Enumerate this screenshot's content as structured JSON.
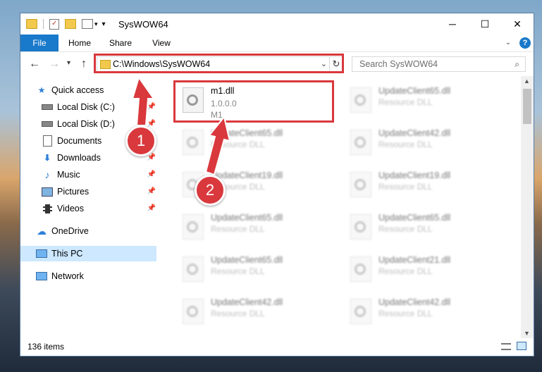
{
  "window": {
    "title": "SysWOW64",
    "controls": {
      "minimize": "─",
      "maximize": "☐",
      "close": "✕"
    }
  },
  "ribbon": {
    "tabs": [
      "File",
      "Home",
      "Share",
      "View"
    ],
    "help_icon": "?",
    "expand_icon": "⌄"
  },
  "address_bar": {
    "path": "C:\\Windows\\SysWOW64",
    "search_placeholder": "Search SysWOW64"
  },
  "sidebar": {
    "quick_access": "Quick access",
    "items": [
      {
        "label": "Local Disk (C:)",
        "icon": "drive-icon"
      },
      {
        "label": "Local Disk (D:)",
        "icon": "drive-icon"
      },
      {
        "label": "Documents",
        "icon": "documents-icon"
      },
      {
        "label": "Downloads",
        "icon": "downloads-icon"
      },
      {
        "label": "Music",
        "icon": "music-icon"
      },
      {
        "label": "Pictures",
        "icon": "pictures-icon"
      },
      {
        "label": "Videos",
        "icon": "videos-icon"
      }
    ],
    "onedrive": "OneDrive",
    "this_pc": "This PC",
    "network": "Network"
  },
  "files": {
    "highlighted": {
      "name": "m1.dll",
      "version": "1.0.0.0",
      "description": "M1"
    },
    "right_column": [
      {
        "name": "UpdateClient65.dll",
        "type": "Resource DLL"
      },
      {
        "name": "UpdateClient42.dll",
        "type": "Resource DLL"
      },
      {
        "name": "UpdateClient19.dll",
        "type": "Resource DLL"
      },
      {
        "name": "UpdateClient65.dll",
        "type": "Resource DLL"
      },
      {
        "name": "UpdateClient21.dll",
        "type": "Resource DLL"
      },
      {
        "name": "UpdateClient42.dll",
        "type": "Resource DLL"
      }
    ],
    "left_column": [
      {
        "name": "UpdateClient65.dll",
        "type": "Resource DLL"
      },
      {
        "name": "UpdateClient19.dll",
        "type": "Resource DLL"
      },
      {
        "name": "UpdateClient65.dll",
        "type": "Resource DLL"
      },
      {
        "name": "UpdateClient65.dll",
        "type": "Resource DLL"
      },
      {
        "name": "UpdateClient42.dll",
        "type": "Resource DLL"
      }
    ]
  },
  "status": {
    "item_count": "136 items"
  },
  "annotations": {
    "callout_1": "1",
    "callout_2": "2",
    "color": "#d9383d"
  }
}
